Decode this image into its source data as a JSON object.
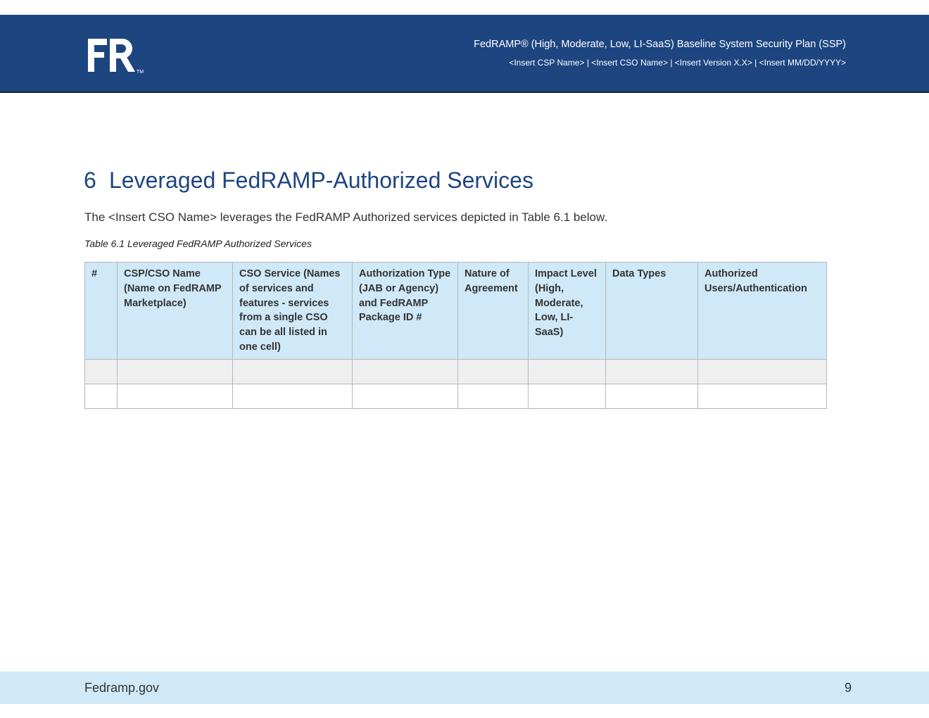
{
  "header": {
    "title": "FedRAMP® (High, Moderate, Low, LI-SaaS) Baseline System Security Plan (SSP)",
    "subtitle": "<Insert CSP Name> | <Insert CSO Name> | <Insert Version X.X> | <Insert MM/DD/YYYY>",
    "logo_text": "FR",
    "logo_tm": "TM"
  },
  "section": {
    "number": "6",
    "title": "Leveraged FedRAMP-Authorized Services",
    "body": "The <Insert CSO Name> leverages the FedRAMP Authorized services depicted in Table 6.1 below."
  },
  "table": {
    "caption": "Table 6.1 Leveraged FedRAMP Authorized Services",
    "columns": [
      "#",
      "CSP/CSO Name (Name on FedRAMP Marketplace)",
      "CSO Service (Names of services and features - services from a single CSO can be all listed in one cell)",
      "Authorization Type (JAB or Agency) and FedRAMP Package ID #",
      "Nature of Agreement",
      "Impact Level (High, Moderate, Low, LI-SaaS)",
      "Data Types",
      "Authorized Users/Authentication"
    ],
    "rows": [
      [
        "",
        "",
        "",
        "",
        "",
        "",
        "",
        ""
      ],
      [
        "",
        "",
        "",
        "",
        "",
        "",
        "",
        ""
      ]
    ]
  },
  "footer": {
    "site": "Fedramp.gov",
    "page_number": "9"
  },
  "colors": {
    "brand_blue": "#1d4580",
    "light_blue": "#cfe9f8",
    "row_shade": "#efefef"
  }
}
